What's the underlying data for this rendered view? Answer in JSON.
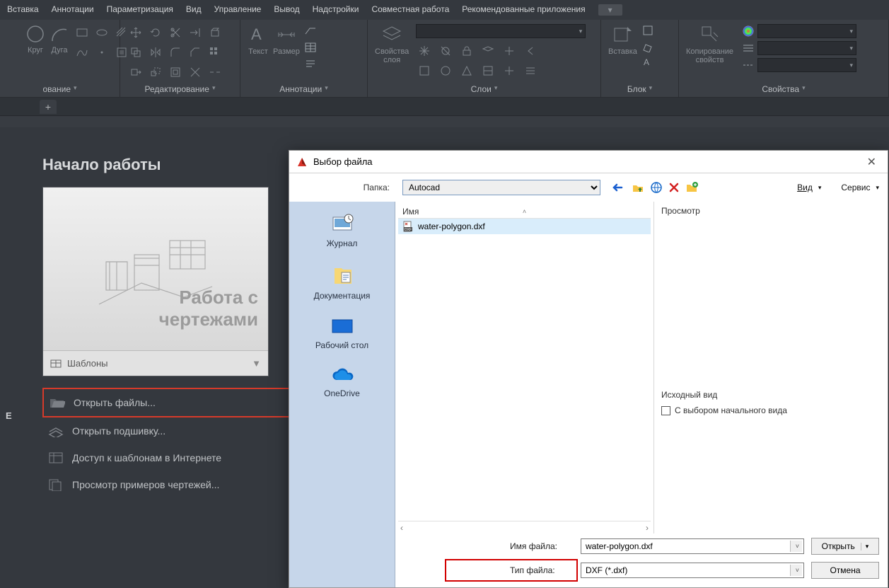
{
  "menubar": [
    "Вставка",
    "Аннотации",
    "Параметризация",
    "Вид",
    "Управление",
    "Вывод",
    "Надстройки",
    "Совместная работа",
    "Рекомендованные приложения"
  ],
  "ribbon": {
    "draw": {
      "circle": "Круг",
      "arc": "Дуга",
      "title": "ование"
    },
    "edit": {
      "title": "Редактирование"
    },
    "annot": {
      "text": "Текст",
      "dim": "Размер",
      "title": "Аннотации"
    },
    "layers": {
      "props": "Свойства\nслоя",
      "title": "Слои"
    },
    "block": {
      "insert": "Вставка",
      "title": "Блок"
    },
    "props": {
      "copy": "Копирование\nсвойств",
      "title": "Свойства"
    }
  },
  "start": {
    "heading": "Начало работы",
    "card_line1": "Работа с",
    "card_line2": "чертежами",
    "templates": "Шаблоны",
    "open_files": "Открыть файлы...",
    "open_sheet": "Открыть подшивку...",
    "templates_online": "Доступ к шаблонам в Интернете",
    "examples": "Просмотр примеров чертежей..."
  },
  "dialog": {
    "title": "Выбор файла",
    "folder_label": "Папка:",
    "folder_value": "Autocad",
    "view_label": "Вид",
    "tools_label": "Сервис",
    "places": {
      "journal": "Журнал",
      "docs": "Документация",
      "desktop": "Рабочий стол",
      "onedrive": "OneDrive"
    },
    "col_name": "Имя",
    "file": "water-polygon.dxf",
    "preview": "Просмотр",
    "origin_view": "Исходный вид",
    "origin_chk": "С выбором начального вида",
    "filename_label": "Имя файла:",
    "filename_value": "water-polygon.dxf",
    "filetype_label": "Тип файла:",
    "filetype_value": "DXF (*.dxf)",
    "open": "Открыть",
    "cancel": "Отмена"
  }
}
